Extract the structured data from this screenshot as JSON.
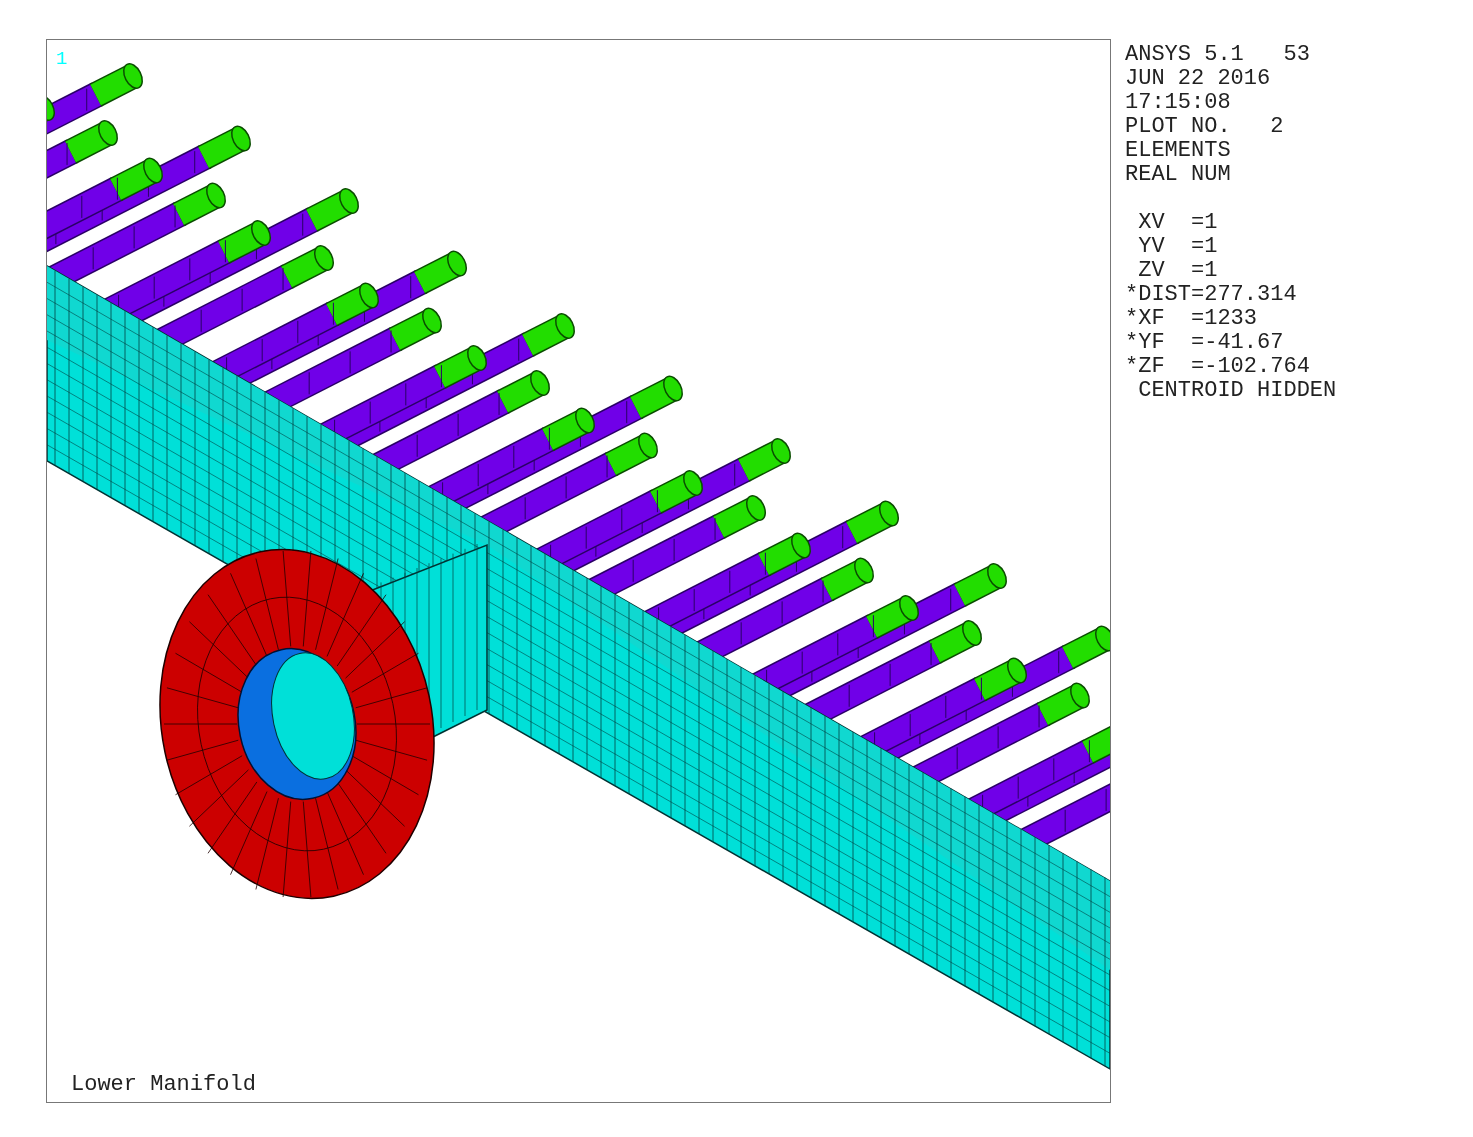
{
  "viewport": {
    "element_number": "1",
    "title": "Lower Manifold"
  },
  "info_panel": {
    "header_lines": [
      "ANSYS 5.1   53",
      "JUN 22 2016",
      "17:15:08",
      "PLOT NO.   2",
      "ELEMENTS",
      "REAL NUM"
    ],
    "view_lines": [
      " XV  =1",
      " YV  =1",
      " ZV  =1",
      "*DIST=277.314",
      "*XF  =1233",
      "*YF  =-41.67",
      "*ZF  =-102.764",
      " CENTROID HIDDEN"
    ]
  }
}
